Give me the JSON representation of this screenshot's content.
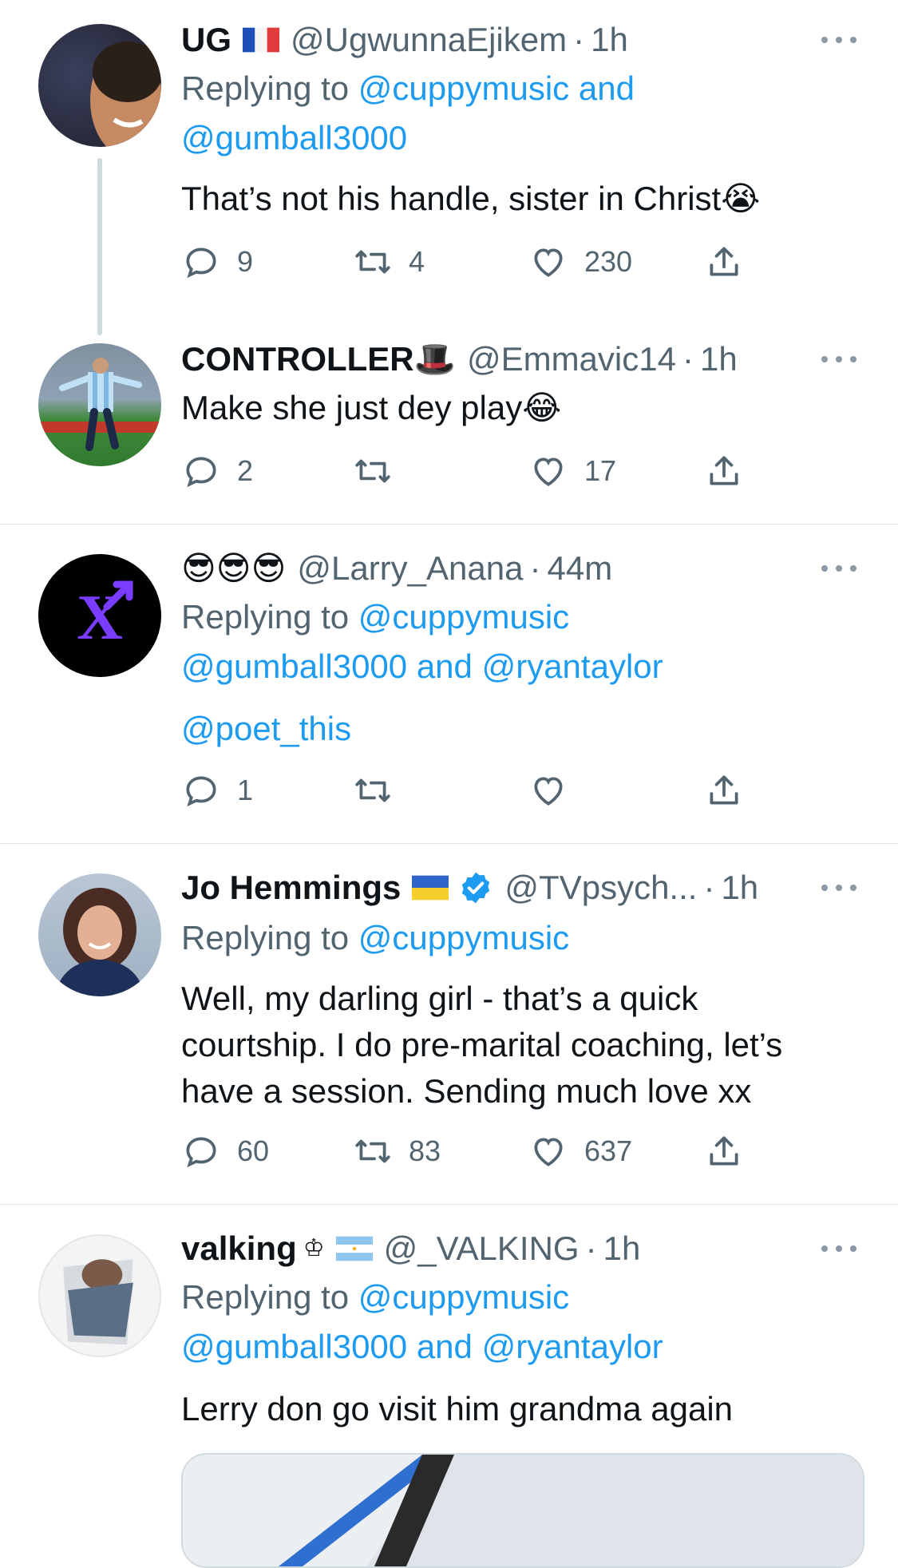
{
  "tweets": [
    {
      "name": "UG",
      "handle": "@UgwunnaEjikem",
      "time": "1h",
      "replying_prefix": "Replying to ",
      "replying_line1": "@cuppymusic and",
      "replying_line2": "@gumball3000",
      "text": "That’s not his handle, sister in Christ😭",
      "replies": "9",
      "retweets": "4",
      "likes": "230"
    },
    {
      "name": "CONTROLLER🎩",
      "handle": "@Emmavic14",
      "time": "1h",
      "text": "Make she just dey play😂",
      "replies": "2",
      "retweets": "",
      "likes": "17"
    },
    {
      "name": "😎😎😎",
      "handle": "@Larry_Anana",
      "time": "44m",
      "replying_prefix": "Replying to ",
      "replying_line1": "@cuppymusic",
      "replying_line2a": "@gumball3000",
      "replying_and": " and ",
      "replying_line2b": "@ryantaylor",
      "extra_link": "@poet_this",
      "replies": "1",
      "retweets": "",
      "likes": ""
    },
    {
      "name": "Jo Hemmings",
      "handle": "@TVpsych...",
      "time": "1h",
      "replying_prefix": "Replying to ",
      "replying_line1": "@cuppymusic",
      "text_l1": "Well, my darling girl - that’s a quick",
      "text_l2": "courtship. I do pre-marital coaching, let’s",
      "text_l3": "have a session. Sending much love xx",
      "replies": "60",
      "retweets": "83",
      "likes": "637"
    },
    {
      "name": "valking",
      "crown": "♔",
      "handle": "@_VALKING",
      "time": "1h",
      "replying_prefix": "Replying to ",
      "replying_line1": "@cuppymusic",
      "replying_line2a": "@gumball3000",
      "replying_and": " and ",
      "replying_line2b": "@ryantaylor",
      "text": "Lerry don go visit him grandma again"
    }
  ],
  "dot": "·",
  "colors": {
    "link": "#1d9bf0",
    "muted": "#536471",
    "text": "#0f1419"
  }
}
